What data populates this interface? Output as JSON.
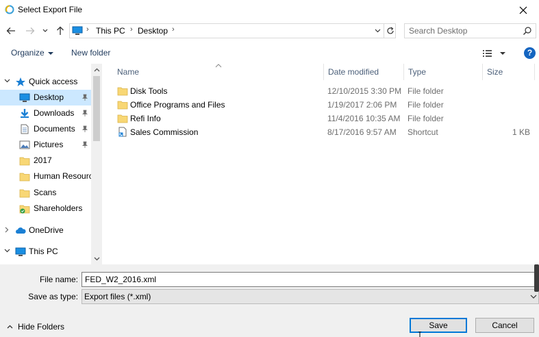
{
  "window": {
    "title": "Select Export File",
    "close_icon": "close-icon"
  },
  "address_bar": {
    "crumbs": [
      "This PC",
      "Desktop"
    ],
    "search_placeholder": "Search Desktop"
  },
  "command_bar": {
    "organize": "Organize",
    "new_folder": "New folder",
    "help": "?"
  },
  "nav_pane": {
    "items": [
      {
        "label": "Quick access",
        "icon": "star-icon",
        "pinned": false,
        "selected": false
      },
      {
        "label": "Desktop",
        "icon": "desktop-icon",
        "pinned": true,
        "selected": true
      },
      {
        "label": "Downloads",
        "icon": "download-icon",
        "pinned": true,
        "selected": false
      },
      {
        "label": "Documents",
        "icon": "document-icon",
        "pinned": true,
        "selected": false
      },
      {
        "label": "Pictures",
        "icon": "pictures-icon",
        "pinned": true,
        "selected": false
      },
      {
        "label": "2017",
        "icon": "folder-icon",
        "pinned": false,
        "selected": false
      },
      {
        "label": "Human Resourc",
        "icon": "folder-icon",
        "pinned": false,
        "selected": false
      },
      {
        "label": "Scans",
        "icon": "folder-icon",
        "pinned": false,
        "selected": false
      },
      {
        "label": "Shareholders",
        "icon": "shared-folder-icon",
        "pinned": false,
        "selected": false
      },
      {
        "label": "OneDrive",
        "icon": "cloud-icon",
        "pinned": false,
        "selected": false
      },
      {
        "label": "This PC",
        "icon": "computer-icon",
        "pinned": false,
        "selected": false
      }
    ]
  },
  "file_list": {
    "columns": [
      "Name",
      "Date modified",
      "Type",
      "Size"
    ],
    "rows": [
      {
        "name": "Disk Tools",
        "date": "12/10/2015 3:30 PM",
        "type": "File folder",
        "size": "",
        "icon": "folder-icon"
      },
      {
        "name": "Office Programs and Files",
        "date": "1/19/2017 2:06 PM",
        "type": "File folder",
        "size": "",
        "icon": "folder-icon"
      },
      {
        "name": "Refi Info",
        "date": "11/4/2016 10:35 AM",
        "type": "File folder",
        "size": "",
        "icon": "folder-icon"
      },
      {
        "name": "Sales Commission",
        "date": "8/17/2016 9:57 AM",
        "type": "Shortcut",
        "size": "1 KB",
        "icon": "shortcut-icon"
      }
    ]
  },
  "form": {
    "file_name_label": "File name:",
    "file_name_value": "FED_W2_2016.xml",
    "save_type_label": "Save as type:",
    "save_type_value": "Export files (*.xml)",
    "hide_folders": "Hide Folders",
    "save": "Save",
    "cancel": "Cancel"
  },
  "colors": {
    "selection": "#cce8ff",
    "accent": "#0078d7",
    "folder": "#f8d775"
  }
}
